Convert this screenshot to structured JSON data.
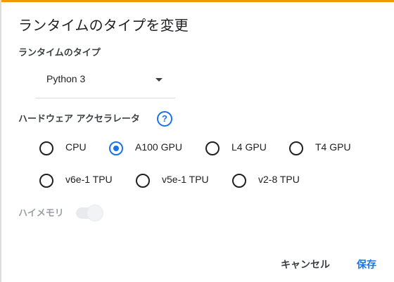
{
  "dialog": {
    "title": "ランタイムのタイプを変更"
  },
  "runtime_type": {
    "label": "ランタイムのタイプ",
    "selected": "Python 3"
  },
  "accelerator": {
    "label": "ハードウェア アクセラレータ",
    "help_icon_glyph": "?",
    "options": [
      {
        "label": "CPU",
        "checked": false
      },
      {
        "label": "A100 GPU",
        "checked": true
      },
      {
        "label": "L4 GPU",
        "checked": false
      },
      {
        "label": "T4 GPU",
        "checked": false
      },
      {
        "label": "v6e-1 TPU",
        "checked": false
      },
      {
        "label": "v5e-1 TPU",
        "checked": false
      },
      {
        "label": "v2-8 TPU",
        "checked": false
      }
    ]
  },
  "high_memory": {
    "label": "ハイメモリ",
    "enabled": false
  },
  "buttons": {
    "cancel": "キャンセル",
    "save": "保存"
  },
  "colors": {
    "accent": "#1a73e8",
    "top_bar": "#f29900",
    "disabled": "#9aa0a6"
  }
}
